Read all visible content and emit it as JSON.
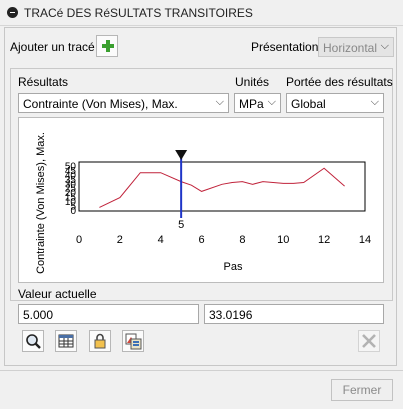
{
  "window": {
    "title": "TRACé DES RéSULTATS TRANSITOIRES",
    "collapse_icon": "collapse-icon"
  },
  "top": {
    "add_label": "Ajouter un tracé",
    "add_icon": "plus-icon",
    "presentation_label": "Présentation",
    "presentation_value": "Horizontal"
  },
  "selectors": {
    "results_label": "Résultats",
    "results_value": "Contrainte (Von Mises), Max.",
    "units_label": "Unités",
    "units_value": "MPa",
    "scope_label": "Portée des résultats",
    "scope_value": "Global"
  },
  "chart_data": {
    "type": "line",
    "xlabel": "Pas",
    "ylabel": "Contrainte (Von Mises), Max.",
    "xlim": [
      0,
      14
    ],
    "ylim": [
      0,
      55
    ],
    "x_ticks": [
      "0",
      "2",
      "4",
      "6",
      "8",
      "10",
      "12",
      "14"
    ],
    "y_ticks": [
      "0",
      "5",
      "10",
      "15",
      "20",
      "25",
      "30",
      "35",
      "40",
      "45",
      "50"
    ],
    "grid": true,
    "line_color": "#c0223a",
    "marker_color": "#1f35c8",
    "marker_x": 5,
    "marker_label": "5",
    "series": [
      {
        "x": [
          1,
          2,
          3,
          4,
          5,
          5.5,
          6,
          7,
          7.5,
          8,
          8.5,
          9,
          10,
          10.5,
          11,
          12,
          13
        ],
        "values": [
          4,
          15,
          43,
          43,
          33,
          29,
          22,
          30,
          32,
          33,
          30,
          33,
          31,
          31,
          32,
          48,
          28
        ]
      }
    ]
  },
  "current_value": {
    "label": "Valeur actuelle",
    "step": "5.000",
    "value": "33.0196"
  },
  "toolbar": {
    "icons": [
      "zoom-icon",
      "table-icon",
      "lock-icon",
      "image-export-icon",
      "delete-icon"
    ]
  },
  "footer": {
    "close_label": "Fermer"
  }
}
